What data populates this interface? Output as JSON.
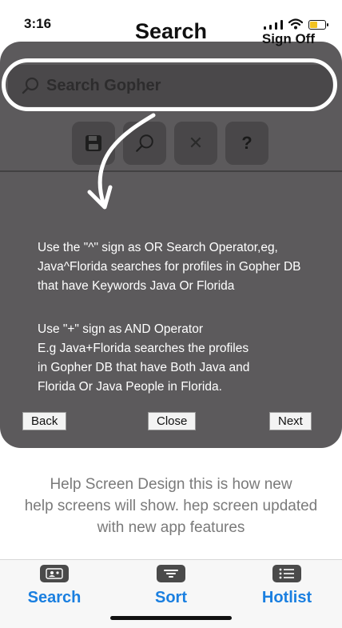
{
  "status": {
    "time": "3:16",
    "battery_level": 0.55
  },
  "header": {
    "title": "Search",
    "sign_off": "Sign Off"
  },
  "search": {
    "placeholder": "Search Gopher"
  },
  "toolbar": {
    "buttons": [
      {
        "icon": "save-icon"
      },
      {
        "icon": "search-icon"
      },
      {
        "icon": "close-icon",
        "glyph": "✕"
      },
      {
        "icon": "help-icon",
        "glyph": "?"
      }
    ]
  },
  "help": {
    "para1": [
      "Use the \"^\" sign as OR Search Operator,eg,",
      "Java^Florida searches for profiles in Gopher DB",
      "that have  Keywords Java Or Florida"
    ],
    "para2": [
      "Use \"+\" sign as AND Operator",
      "E.g Java+Florida searches the profiles",
      "in Gopher DB that have Both Java and",
      "Florida Or Java People in Florida."
    ],
    "back_label": "Back",
    "close_label": "Close",
    "next_label": "Next"
  },
  "caption": [
    "Help Screen Design this is how new",
    "help screens will show. hep screen updated",
    "with new app features"
  ],
  "tabs": [
    {
      "label": "Search",
      "icon": "profile-card-icon"
    },
    {
      "label": "Sort",
      "icon": "sort-icon"
    },
    {
      "label": "Hotlist",
      "icon": "list-icon"
    }
  ],
  "colors": {
    "accent": "#1a7fe0",
    "overlay": "#504e50",
    "battery": "#f2c321"
  }
}
